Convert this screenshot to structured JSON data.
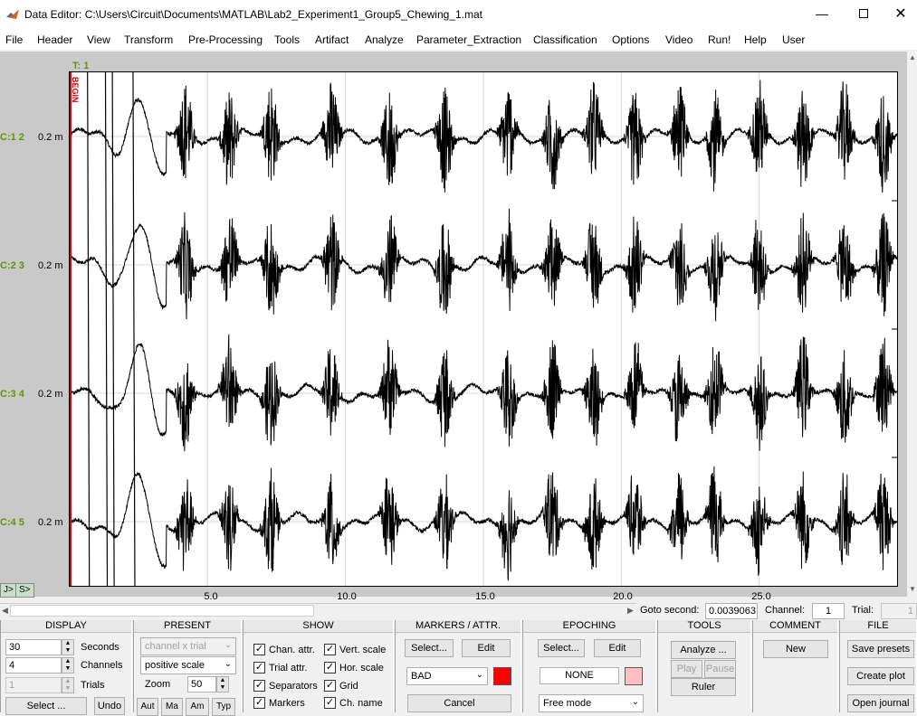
{
  "window": {
    "title": "Data Editor: C:\\Users\\Circuit\\Documents\\MATLAB\\Lab2_Experiment1_Group5_Chewing_1.mat"
  },
  "menu": [
    "File",
    "Header",
    "View",
    "Transform",
    "Pre-Processing",
    "Tools",
    "Artifact",
    "Analyze",
    "Parameter_Extraction",
    "Classification",
    "Options",
    "Video",
    "Run!",
    "Help",
    "User"
  ],
  "plot": {
    "trial_label": "T: 1",
    "begin_marker": "BEGIN",
    "channels": [
      {
        "name": "C:1",
        "num": "2",
        "scale": "0.2 m"
      },
      {
        "name": "C:2",
        "num": "3",
        "scale": "0.2 m"
      },
      {
        "name": "C:3",
        "num": "4",
        "scale": "0.2 m"
      },
      {
        "name": "C:4",
        "num": "5",
        "scale": "0.2 m"
      }
    ],
    "xticks": [
      "5.0",
      "10.0",
      "15.0",
      "20.0",
      "25.0"
    ],
    "scroll_buttons": [
      "J>",
      "S>"
    ]
  },
  "chart_data": {
    "type": "line",
    "title": "",
    "xlabel": "",
    "ylabel": "",
    "xlim": [
      0.0039063,
      30
    ],
    "xticks": [
      5,
      10,
      15,
      20,
      25
    ],
    "grid": true,
    "series_count": 4,
    "chew_bursts_seconds": [
      4.2,
      5.8,
      7.3,
      9.5,
      11.6,
      13.6,
      15.9,
      17.5,
      19.0,
      20.5,
      22.1,
      23.4,
      25.0,
      26.6,
      28.1,
      29.5
    ]
  },
  "goto": {
    "label": "Goto second:",
    "value": "0.0039063",
    "channel_label": "Channel:",
    "channel_value": "1",
    "trial_label": "Trial:",
    "trial_value": "1"
  },
  "display": {
    "head": "DISPLAY",
    "seconds_value": "30",
    "seconds_label": "Seconds",
    "channels_value": "4",
    "channels_label": "Channels",
    "trials_value": "1",
    "trials_label": "Trials",
    "select": "Select ...",
    "undo": "Undo"
  },
  "present": {
    "head": "PRESENT",
    "mode": "channel x trial",
    "scale": "positive scale",
    "zoom_label": "Zoom",
    "zoom_value": "50",
    "btns": [
      "Aut",
      "Ma",
      "Am",
      "Typ"
    ]
  },
  "show": {
    "head": "SHOW",
    "items": [
      "Chan. attr.",
      "Trial attr.",
      "Separators",
      "Markers",
      "Vert. scale",
      "Hor. scale",
      "Grid",
      "Ch. name"
    ]
  },
  "markers": {
    "head": "MARKERS / ATTR.",
    "select": "Select...",
    "edit": "Edit",
    "type": "BAD",
    "color": "#ff0000",
    "cancel": "Cancel"
  },
  "epoching": {
    "head": "EPOCHING",
    "select": "Select...",
    "edit": "Edit",
    "mode": "NONE",
    "color": "#ffc0c0",
    "free": "Free mode"
  },
  "tools": {
    "head": "TOOLS",
    "analyze": "Analyze ...",
    "play": "Play",
    "pause": "Pause",
    "ruler": "Ruler"
  },
  "comment": {
    "head": "COMMENT",
    "new": "New"
  },
  "file": {
    "head": "FILE",
    "save": "Save presets",
    "plot": "Create plot",
    "journal": "Open journal"
  }
}
